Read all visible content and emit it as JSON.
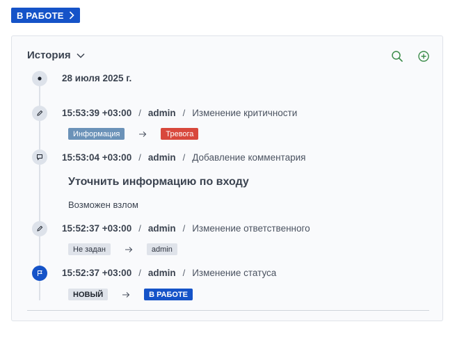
{
  "status_button": {
    "label": "В РАБОТЕ"
  },
  "history": {
    "title": "История",
    "date": "28 июля 2025 г.",
    "entries": [
      {
        "time": "15:53:39 +03:00",
        "user": "admin",
        "action": "Изменение критичности",
        "from": "Информация",
        "to": "Тревога"
      },
      {
        "time": "15:53:04 +03:00",
        "user": "admin",
        "action": "Добавление комментария",
        "comment_title": "Уточнить информацию по входу",
        "comment_body": "Возможен взлом"
      },
      {
        "time": "15:52:37 +03:00",
        "user": "admin",
        "action": "Изменение ответственного",
        "from": "Не задан",
        "to": "admin"
      },
      {
        "time": "15:52:37 +03:00",
        "user": "admin",
        "action": "Изменение статуса",
        "from": "НОВЫЙ",
        "to": "В РАБОТЕ"
      }
    ]
  },
  "colors": {
    "accent": "#1553c8",
    "info_tag": "#6b92b8",
    "alarm_tag": "#d8483c",
    "action_icon": "#3c8c4a"
  },
  "icons": {
    "status_chevron": "chevron-right-icon",
    "history_toggle": "chevron-down-icon",
    "search": "search-icon",
    "add": "plus-circle-icon"
  }
}
